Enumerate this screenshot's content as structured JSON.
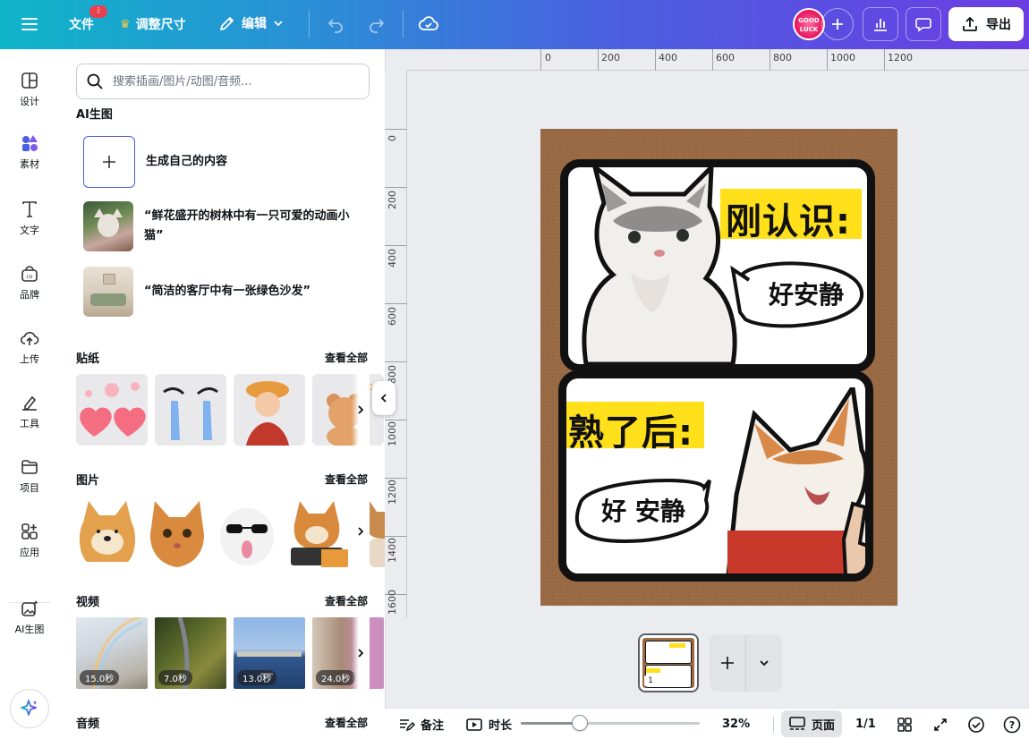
{
  "topbar": {
    "file_label": "文件",
    "file_badge": "ﾐ",
    "resize_label": "调整尺寸",
    "edit_label": "编辑",
    "avatar_text": "GOOD LUCK",
    "export_label": "导出"
  },
  "rail": {
    "items": [
      {
        "label": "设计",
        "icon": "layout-icon"
      },
      {
        "label": "素材",
        "icon": "elements-icon"
      },
      {
        "label": "文字",
        "icon": "text-icon"
      },
      {
        "label": "品牌",
        "icon": "brand-icon"
      },
      {
        "label": "上传",
        "icon": "upload-icon"
      },
      {
        "label": "工具",
        "icon": "draw-icon"
      },
      {
        "label": "项目",
        "icon": "folder-icon"
      },
      {
        "label": "应用",
        "icon": "apps-icon"
      },
      {
        "label": "AI生图",
        "icon": "ai-image-icon"
      }
    ]
  },
  "panel": {
    "search_placeholder": "搜索插画/图片/动图/音频...",
    "ai_section_title": "AI生图",
    "ai_items": [
      {
        "text": "生成自己的内容"
      },
      {
        "text": "“鲜花盛开的树林中有一只可爱的动画小猫”"
      },
      {
        "text": "“简洁的客厅中有一张绿色沙发”"
      }
    ],
    "stickers_title": "贴纸",
    "photos_title": "图片",
    "videos_title": "视频",
    "audio_title": "音频",
    "see_all": "查看全部",
    "video_durations": [
      "15.0秒",
      "7.0秒",
      "13.0秒",
      "24.0秒"
    ]
  },
  "ruler": {
    "top_ticks": [
      "0",
      "200",
      "400",
      "600",
      "800",
      "1000",
      "1200"
    ],
    "left_ticks": [
      "0",
      "200",
      "400",
      "600",
      "800",
      "1000",
      "1200",
      "1400",
      "1600"
    ]
  },
  "design": {
    "top_title": "刚认识:",
    "top_bubble": "好安静",
    "bottom_title": "熟了后:",
    "bottom_bubble": "好 安静"
  },
  "pages": {
    "thumb_number": "1"
  },
  "bottombar": {
    "notes_label": "备注",
    "duration_label": "时长",
    "zoom_value": 32,
    "zoom_text": "32%",
    "pages_label": "页面",
    "page_count": "1/1",
    "help": "?"
  },
  "colors": {
    "topbar_gradient_start": "#0fb5c9",
    "topbar_gradient_end": "#6b3de3",
    "accent": "#4b5fe0",
    "highlight_yellow": "#ffe01b",
    "page_brown": "#9a6b45"
  }
}
